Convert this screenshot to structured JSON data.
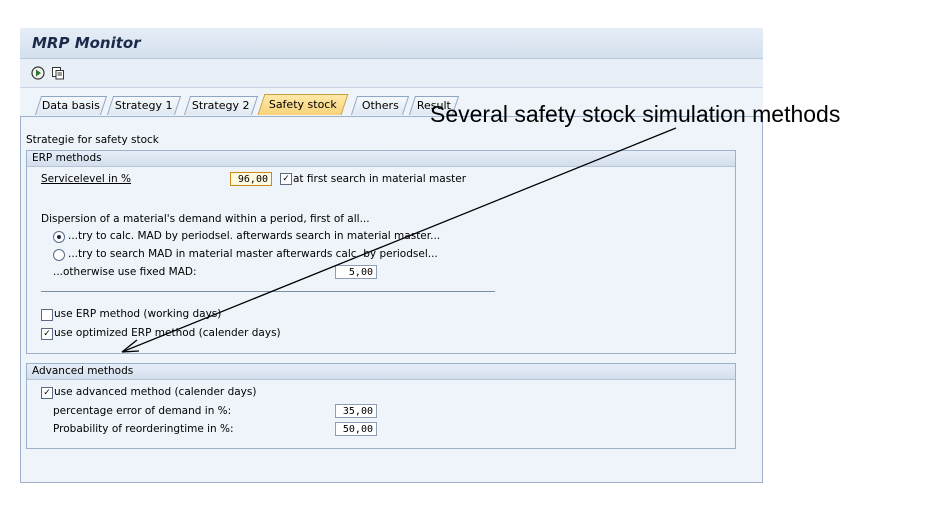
{
  "window": {
    "title": "MRP Monitor"
  },
  "toolbar": {
    "icons": [
      "execute-icon",
      "copy-icon"
    ]
  },
  "tabs": [
    {
      "label": "Data basis"
    },
    {
      "label": "Strategy 1"
    },
    {
      "label": "Strategy 2"
    },
    {
      "label": "Safety stock",
      "active": true
    },
    {
      "label": "Others"
    },
    {
      "label": "Result"
    }
  ],
  "strategy_group": {
    "title": "Strategie for safety stock"
  },
  "erp": {
    "title": "ERP methods",
    "servicelevel_label": "Servicelevel in %",
    "servicelevel_value": "96,00",
    "first_search_label": "at first search in material master",
    "first_search_checked": true,
    "dispersion_label": "Dispersion of a material's demand within a period, first of all...",
    "radio1_label": "...try to calc. MAD by periodsel. afterwards search in material master...",
    "radio2_label": "...try to search MAD in material master afterwards calc. by periodsel...",
    "fixed_mad_label": "...otherwise use fixed MAD:",
    "fixed_mad_value": "5,00",
    "use_erp_label": "use ERP method (working days)",
    "use_erp_checked": false,
    "use_opt_erp_label": "use optimized ERP method (calender days)",
    "use_opt_erp_checked": true
  },
  "advanced": {
    "title": "Advanced methods",
    "use_adv_label": "use advanced method (calender days)",
    "use_adv_checked": true,
    "pct_error_label": "percentage error of demand in %:",
    "pct_error_value": "35,00",
    "prob_label": "Probability of reorderingtime in %:",
    "prob_value": "50,00"
  },
  "annotation": {
    "text": "Several safety stock simulation methods"
  }
}
